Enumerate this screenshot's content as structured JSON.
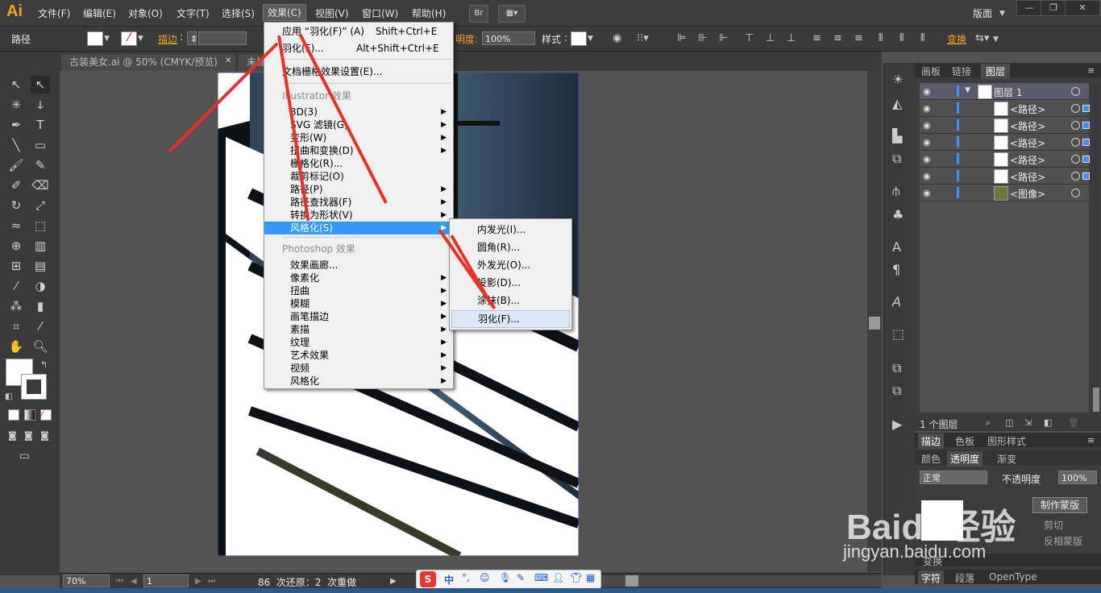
{
  "menubar": {
    "logo": "Ai",
    "items": [
      "文件(F)",
      "编辑(E)",
      "对象(O)",
      "文字(T)",
      "选择(S)",
      "效果(C)",
      "视图(V)",
      "窗口(W)",
      "帮助(H)"
    ],
    "br_button": "Br",
    "workspace": "版面"
  },
  "control_bar": {
    "selection_type": "路径",
    "stroke_label": "描边",
    "opacity_label": "不透明度",
    "opacity_value": "100%",
    "style_label": "样式",
    "transform_label": "变换"
  },
  "document": {
    "tab1": "古装美女.ai @ 50% (CMYK/预览)",
    "tab2": "未标"
  },
  "effect_menu": {
    "apply_last": "应用 “羽化(F)” (A)",
    "apply_last_shortcut": "Shift+Ctrl+E",
    "last_effect": "羽化(F)...",
    "last_effect_shortcut": "Alt+Shift+Ctrl+E",
    "raster_settings": "文档栅格效果设置(E)...",
    "illustrator_header": "Illustrator 效果",
    "illustrator_items": [
      "3D(3)",
      "SVG 滤镜(G)",
      "变形(W)",
      "扭曲和变换(D)",
      "栅格化(R)...",
      "裁剪标记(O)",
      "路径(P)",
      "路径查找器(F)",
      "转换为形状(V)",
      "风格化(S)"
    ],
    "photoshop_header": "Photoshop 效果",
    "photoshop_items": [
      "效果画廊...",
      "像素化",
      "扭曲",
      "模糊",
      "画笔描边",
      "素描",
      "纹理",
      "艺术效果",
      "视频",
      "风格化"
    ]
  },
  "stylize_submenu": {
    "items": [
      "内发光(I)...",
      "圆角(R)...",
      "外发光(O)...",
      "投影(D)...",
      "涂抹(B)...",
      "羽化(F)..."
    ]
  },
  "layers_panel": {
    "tabs": [
      "画板",
      "链接",
      "图层"
    ],
    "layer_name": "图层 1",
    "rows": [
      "<路径>",
      "<路径>",
      "<路径>",
      "<路径>",
      "<路径>",
      "<图像>"
    ],
    "footer_count": "1 个图层"
  },
  "appearance_panel": {
    "tabs1": [
      "描边",
      "色板",
      "图形样式"
    ],
    "tabs2": [
      "颜色",
      "透明度",
      "渐变"
    ],
    "blend_mode": "正常",
    "opacity_label": "不透明度",
    "opacity_value": "100%",
    "make_mask_button": "制作蒙版",
    "clip_label": "剪切",
    "invert_label": "反相蒙版",
    "tabs3": [
      "字符",
      "段落",
      "OpenType"
    ],
    "transform_tab": "变换"
  },
  "status_bar": {
    "zoom": "70%",
    "page": "1",
    "undo_info": "86  次还原：2  次重做"
  },
  "watermark": {
    "brand": "Baidu经验",
    "url": "jingyan.baidu.com"
  },
  "colors": {
    "highlight": "#3399ff",
    "annotation_arrow": "#e8312a",
    "logo": "#f7a21b"
  }
}
